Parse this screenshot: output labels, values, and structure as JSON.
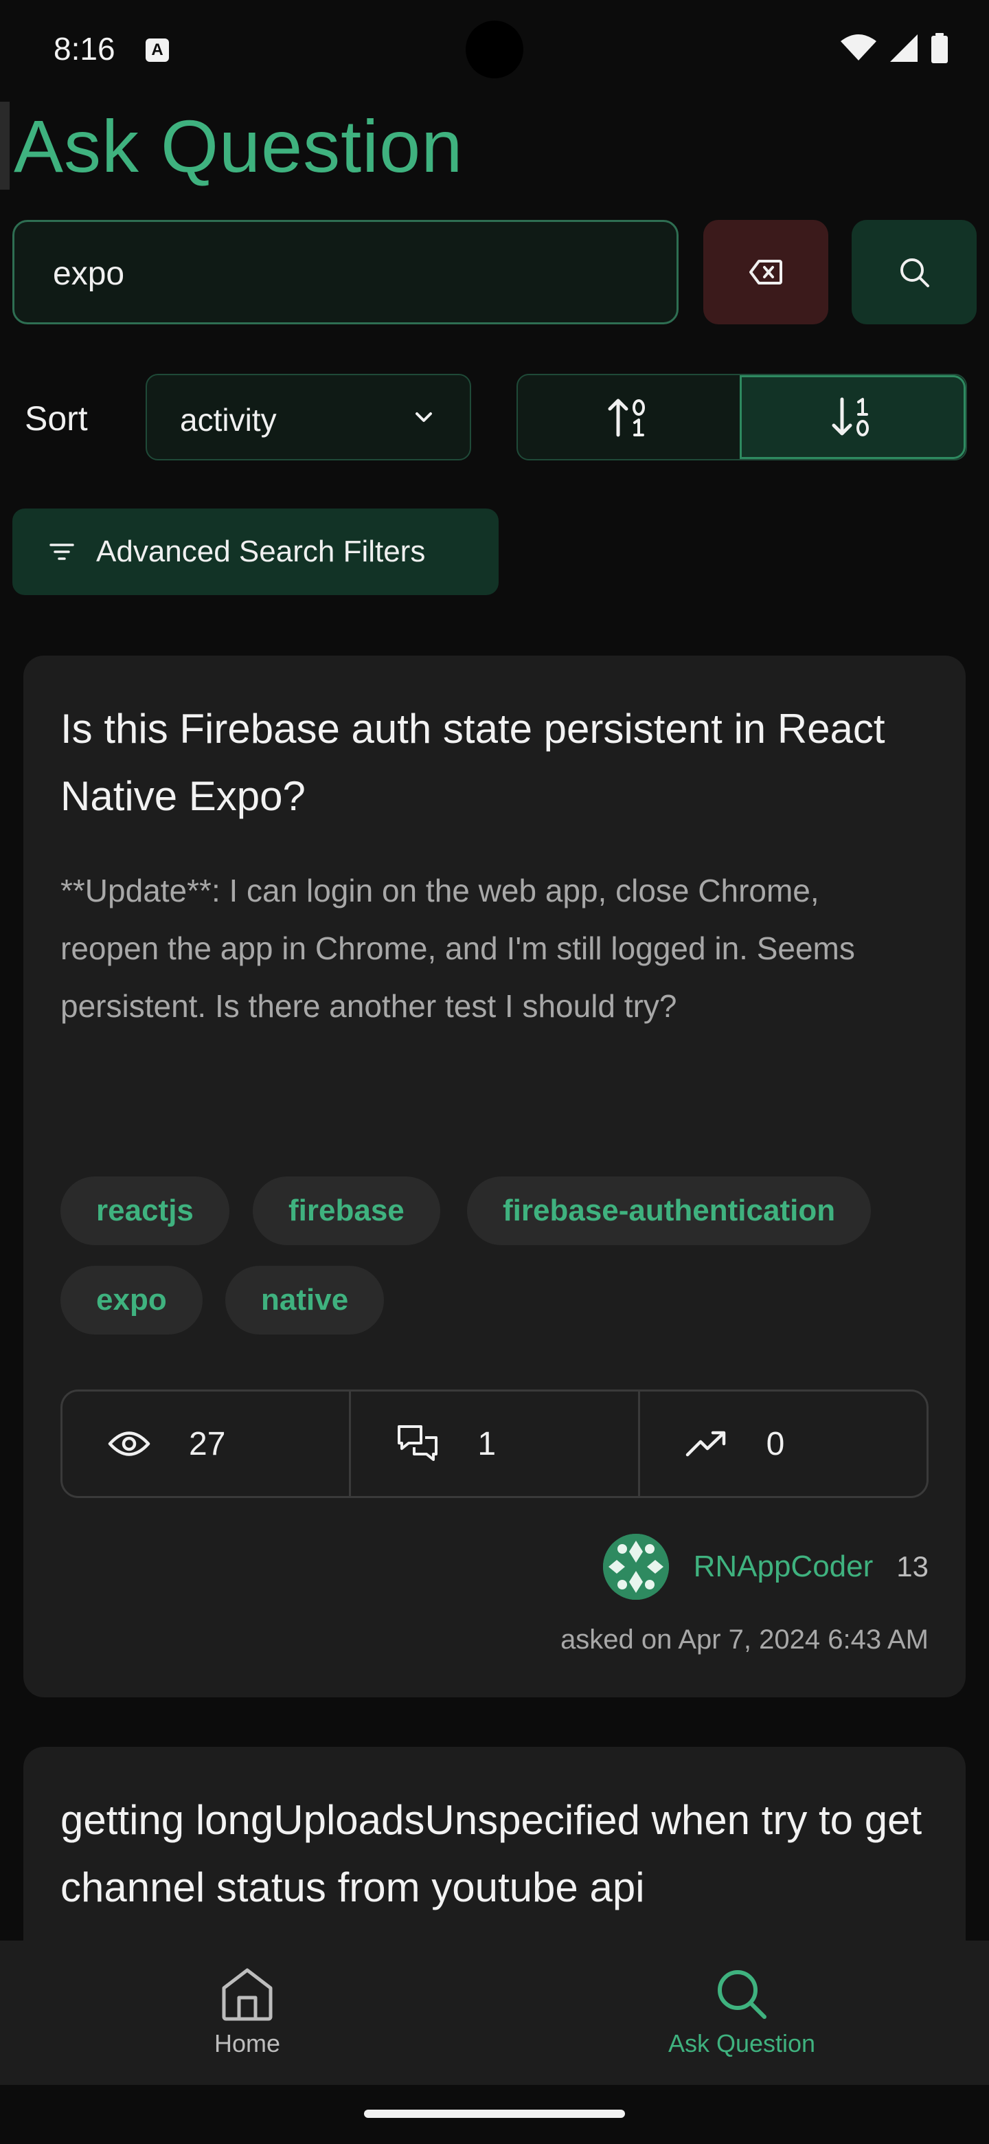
{
  "status_bar": {
    "time": "8:16",
    "notification_glyph": "A"
  },
  "page": {
    "title": "Ask Question"
  },
  "search": {
    "value": "expo",
    "clear_icon": "backspace-icon",
    "search_icon": "search-icon"
  },
  "sort": {
    "label": "Sort",
    "selected": "activity",
    "order_active": "descending"
  },
  "filters": {
    "label": "Advanced Search Filters"
  },
  "questions": [
    {
      "title": "Is this Firebase auth state persistent in React Native Expo?",
      "excerpt": "**Update**: I can login on the web app, close Chrome, reopen the app in Chrome, and I'm still logged in. Seems persistent. Is there another test I should try?",
      "tags": [
        "reactjs",
        "firebase",
        "firebase-authentication",
        "expo",
        "native"
      ],
      "views": "27",
      "answers": "1",
      "score": "0",
      "author": "RNAppCoder",
      "reputation": "13",
      "asked": "asked on Apr 7, 2024 6:43 AM"
    },
    {
      "title": "getting longUploadsUnspecified when try to get channel status from youtube api"
    }
  ],
  "nav": {
    "home_label": "Home",
    "ask_label": "Ask Question",
    "active": "Ask Question"
  },
  "colors": {
    "accent": "#3fb27f",
    "card": "#1d1d1d",
    "danger_bg": "#3b1a1b",
    "success_bg": "#123326"
  }
}
